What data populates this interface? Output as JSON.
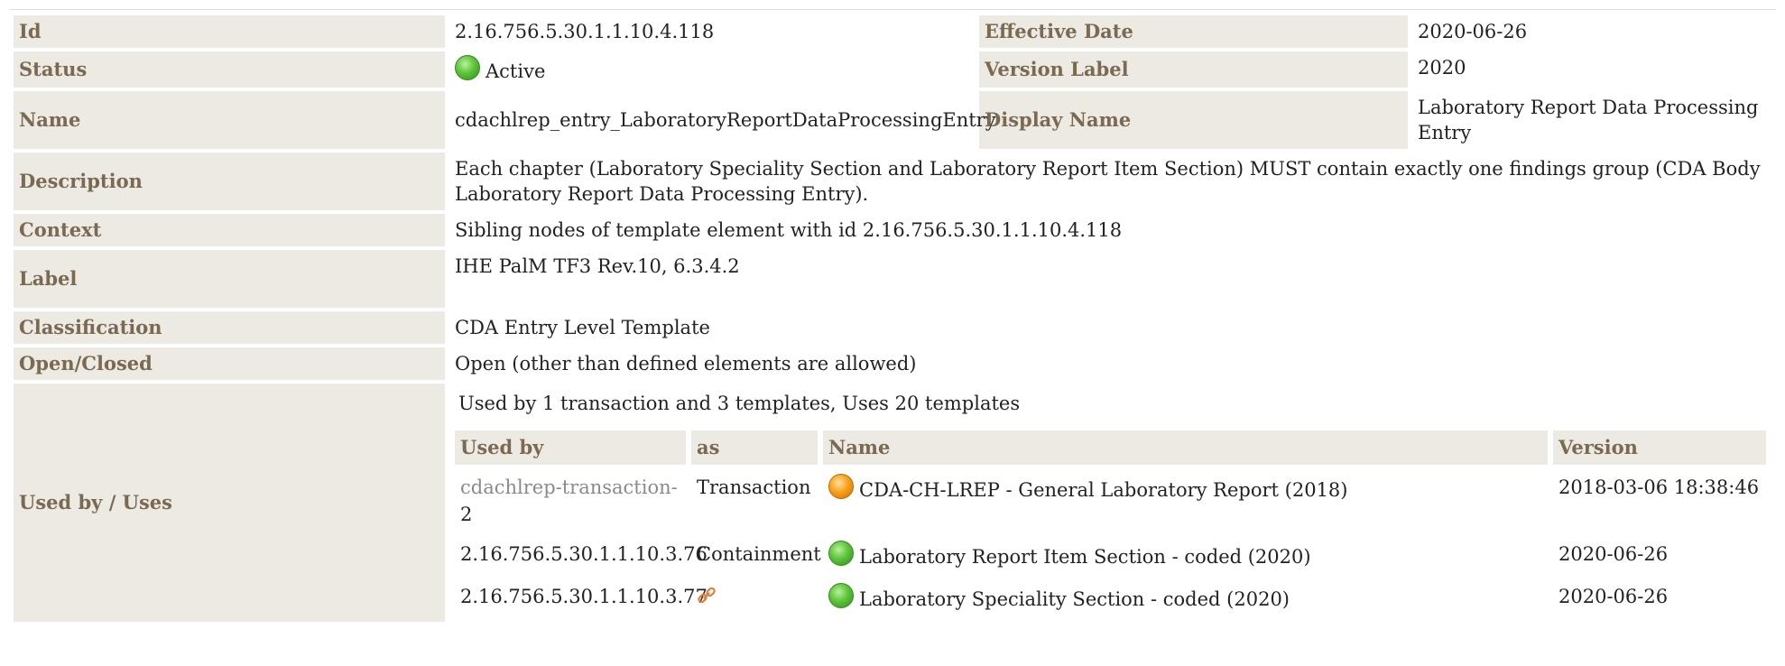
{
  "rows": {
    "id": {
      "label": "Id",
      "value": "2.16.756.5.30.1.1.10.4.118"
    },
    "effective_date": {
      "label": "Effective Date",
      "value": "2020-06-26"
    },
    "status": {
      "label": "Status",
      "value": "Active"
    },
    "version_label": {
      "label": "Version Label",
      "value": "2020"
    },
    "name": {
      "label": "Name",
      "value": "cdachlrep_entry_LaboratoryReportDataProcessingEntry"
    },
    "display_name": {
      "label": "Display Name",
      "value": "Laboratory Report Data Processing Entry"
    },
    "description": {
      "label": "Description",
      "value": "Each chapter (Laboratory Speciality Section and Laboratory Report Item Section) MUST contain exactly one findings group (CDA Body Laboratory Report Data Processing Entry)."
    },
    "context": {
      "label": "Context",
      "value": "Sibling nodes of template element with id 2.16.756.5.30.1.1.10.4.118"
    },
    "label": {
      "label": "Label",
      "value": "IHE PalM TF3 Rev.10, 6.3.4.2"
    },
    "classification": {
      "label": "Classification",
      "value": "CDA Entry Level Template"
    },
    "open_closed": {
      "label": "Open/Closed",
      "value": "Open (other than defined elements are allowed)"
    },
    "used_by": {
      "label": "Used by / Uses"
    }
  },
  "status_colors": {
    "active": "#5cc43a",
    "draft": "#f7a21c"
  },
  "uses": {
    "summary": "Used by 1 transaction and 3 templates, Uses 20 templates",
    "headers": [
      "Used by",
      "as",
      "Name",
      "Version"
    ],
    "rows": [
      {
        "used_by_prefix": "cdachlrep-transaction-",
        "used_by_suffix": "2",
        "as": "Transaction",
        "status_icon": "orange-status-dot-icon",
        "name": "CDA-CH-LREP - General Laboratory Report (2018)",
        "version": "2018-03-06 18:38:46"
      },
      {
        "used_by": "2.16.756.5.30.1.1.10.3.76",
        "as": "Containment",
        "status_icon": "green-status-dot-icon",
        "name": "Laboratory Report Item Section - coded (2020)",
        "version": "2020-06-26"
      },
      {
        "used_by": "2.16.756.5.30.1.1.10.3.77",
        "as_icon": "chain-link-icon",
        "status_icon": "green-status-dot-icon",
        "name": "Laboratory Speciality Section - coded (2020)",
        "version": "2020-06-26"
      }
    ]
  }
}
